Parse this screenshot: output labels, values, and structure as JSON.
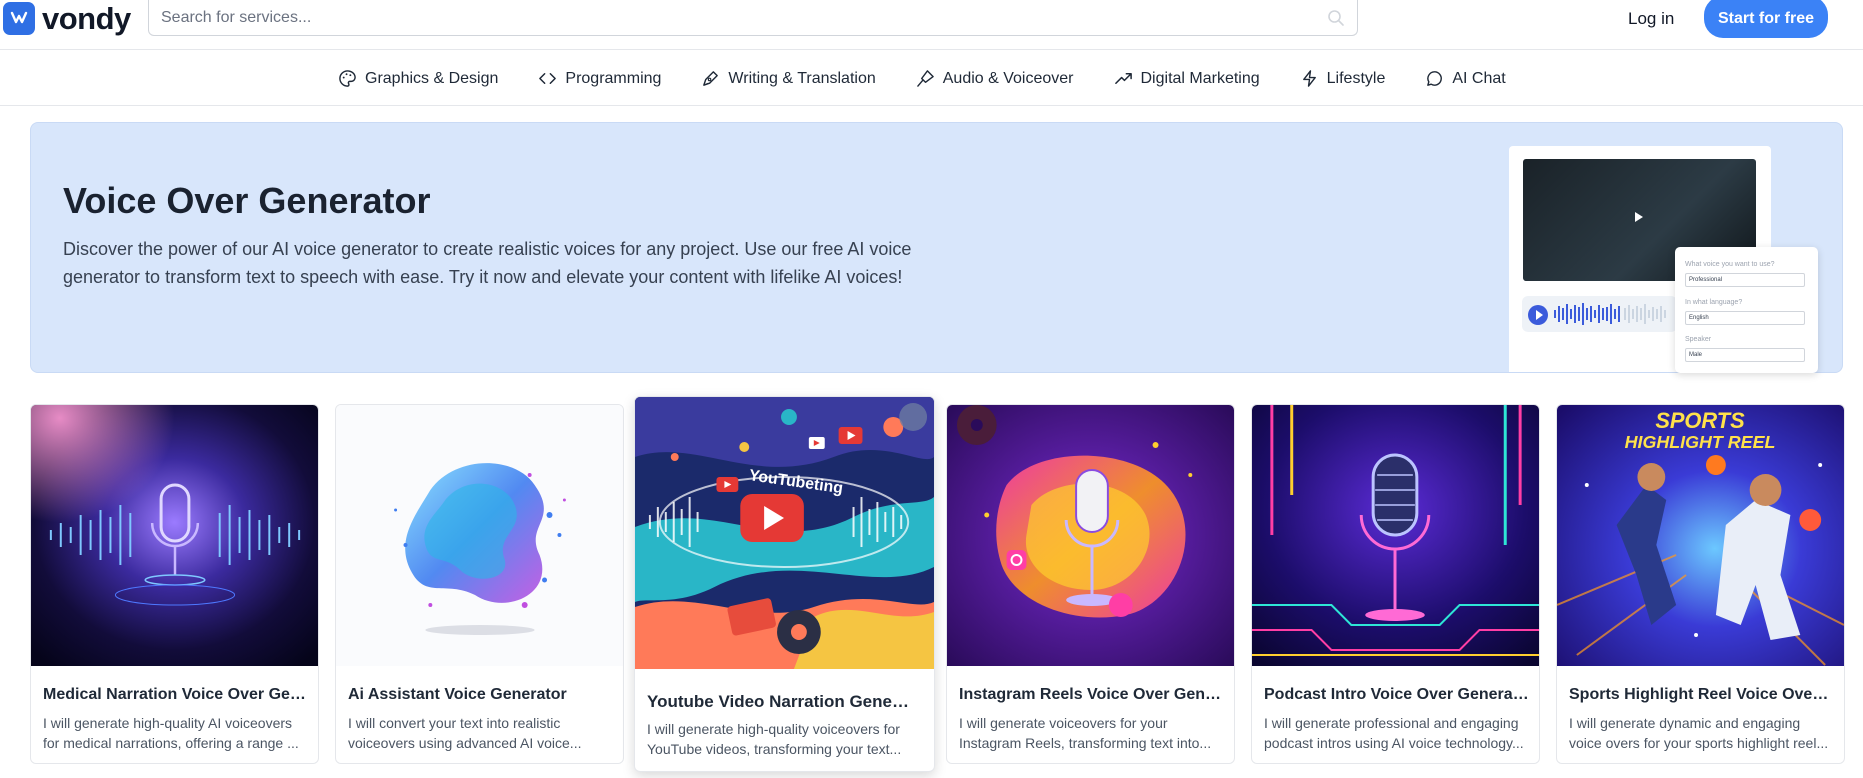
{
  "header": {
    "logo_text": "vondy",
    "search_placeholder": "Search for services...",
    "login_label": "Log in",
    "start_label": "Start for free"
  },
  "categories": [
    {
      "label": "Graphics & Design",
      "icon": "palette-icon"
    },
    {
      "label": "Programming",
      "icon": "code-icon"
    },
    {
      "label": "Writing & Translation",
      "icon": "pen-icon"
    },
    {
      "label": "Audio & Voiceover",
      "icon": "mic-pen-icon"
    },
    {
      "label": "Digital Marketing",
      "icon": "trending-up-icon"
    },
    {
      "label": "Lifestyle",
      "icon": "lightning-icon"
    },
    {
      "label": "AI Chat",
      "icon": "chat-bubble-icon"
    }
  ],
  "hero": {
    "title": "Voice Over Generator",
    "description": "Discover the power of our AI voice generator to create realistic voices for any project. Use our free AI voice generator to transform text to speech with ease. Try it now and elevate your content with lifelike AI voices!",
    "mock": {
      "q1": "What voice you want to use?",
      "a1": "Professional",
      "q2": "In what language?",
      "a2": "English",
      "q3": "Speaker",
      "a3": "Male"
    }
  },
  "cards": [
    {
      "title": "Medical Narration Voice Over Gen...",
      "desc": "I will generate high-quality AI voiceovers for medical narrations, offering a range ..."
    },
    {
      "title": "Ai Assistant Voice Generator",
      "desc": "I will convert your text into realistic voiceovers using advanced AI voice..."
    },
    {
      "title": "Youtube Video Narration Generator",
      "desc": "I will generate high-quality voiceovers for YouTube videos, transforming your text...",
      "image_text": "YouTubeting"
    },
    {
      "title": "Instagram Reels Voice Over Gener...",
      "desc": "I will generate voiceovers for your Instagram Reels, transforming text into..."
    },
    {
      "title": "Podcast Intro Voice Over Generator",
      "desc": "I will generate professional and engaging podcast intros using AI voice technology..."
    },
    {
      "title": "Sports Highlight Reel Voice Over ...",
      "desc": "I will generate dynamic and engaging voice overs for your sports highlight reel...",
      "image_text_1": "SPORTS",
      "image_text_2": "HIGHLIGHT REEL"
    }
  ],
  "colors": {
    "accent": "#3b82f6",
    "hero_bg": "#d8e6fb"
  }
}
